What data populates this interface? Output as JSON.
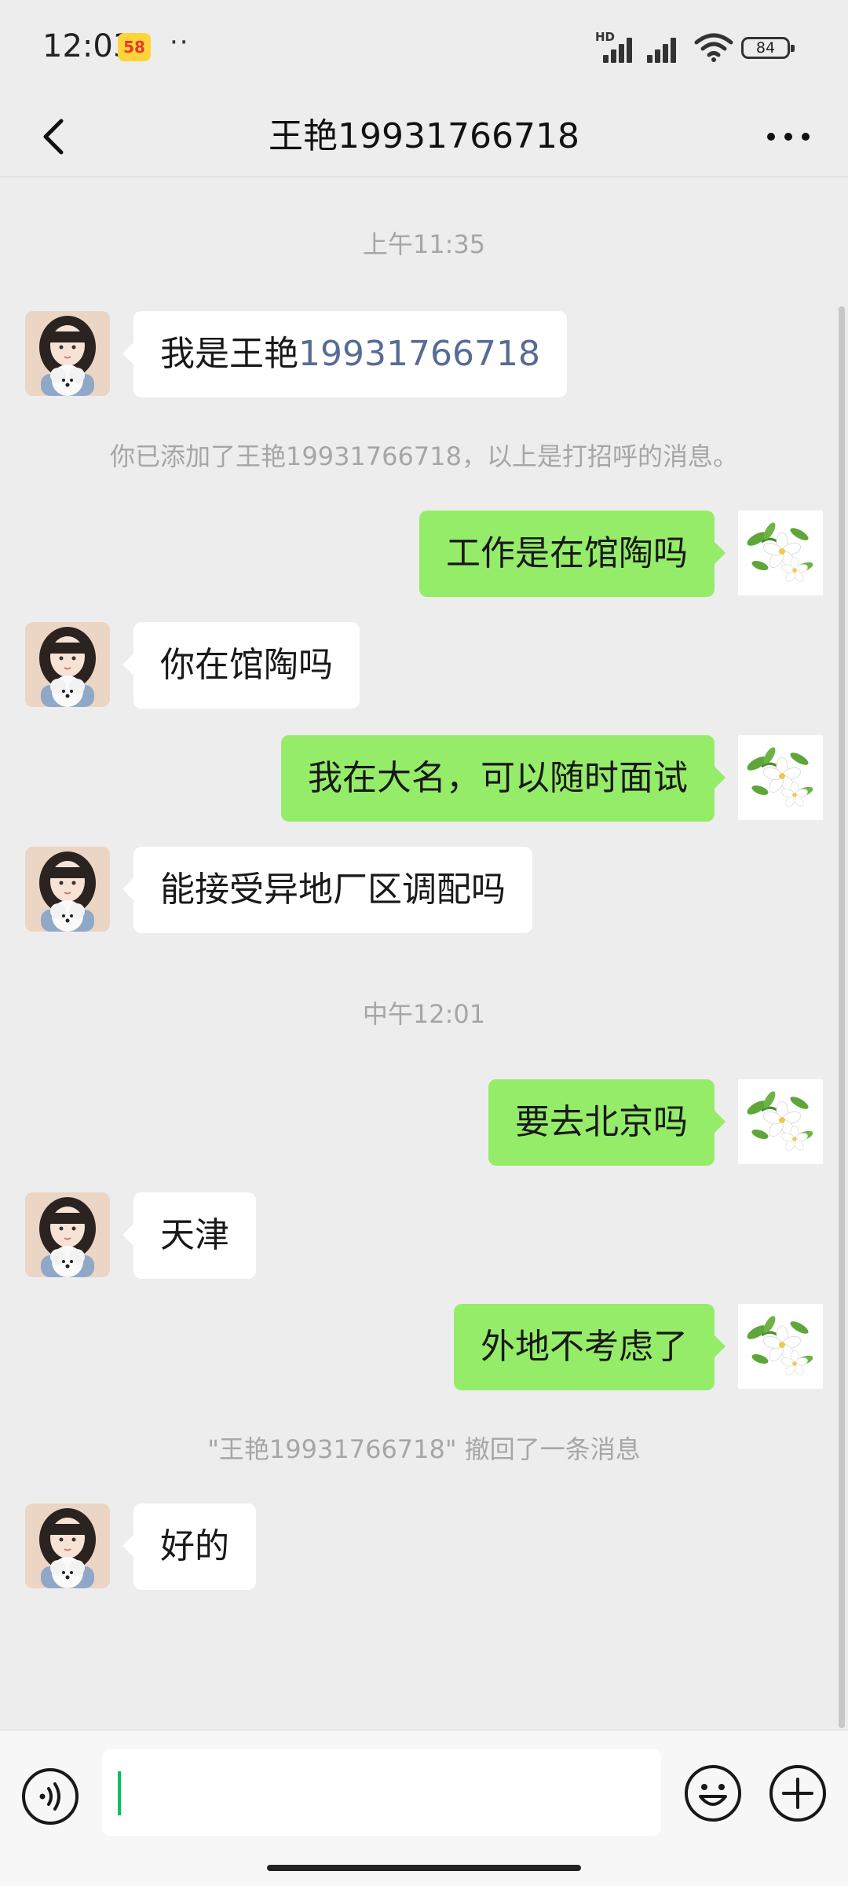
{
  "status_bar": {
    "time": "12:03",
    "app_badge": "58",
    "overflow": "··",
    "network_tag": "HD",
    "battery": "84"
  },
  "header": {
    "title": "王艳19931766718",
    "back_icon": "chevron-left-icon",
    "more_icon": "more-horizontal-icon"
  },
  "chat": {
    "timestamp_1": "上午11:35",
    "msg_1_prefix": "我是王艳",
    "msg_1_phone": "19931766718",
    "system_added": "你已添加了王艳19931766718，以上是打招呼的消息。",
    "msg_2": "工作是在馆陶吗",
    "msg_3": "你在馆陶吗",
    "msg_4": "我在大名，可以随时面试",
    "msg_5": "能接受异地厂区调配吗",
    "timestamp_2": "中午12:01",
    "msg_6": "要去北京吗",
    "msg_7": "天津",
    "msg_8": "外地不考虑了",
    "system_recalled": "\"王艳19931766718\" 撤回了一条消息",
    "msg_9": "好的"
  },
  "input_bar": {
    "voice_icon": "voice-icon",
    "input_value": "",
    "emoji_icon": "emoji-icon",
    "plus_icon": "plus-icon"
  },
  "colors": {
    "background": "#EDEDED",
    "outgoing_bubble": "#95EC69",
    "incoming_bubble": "#FFFFFF",
    "phone_link": "#576B95",
    "cursor": "#07C160"
  }
}
